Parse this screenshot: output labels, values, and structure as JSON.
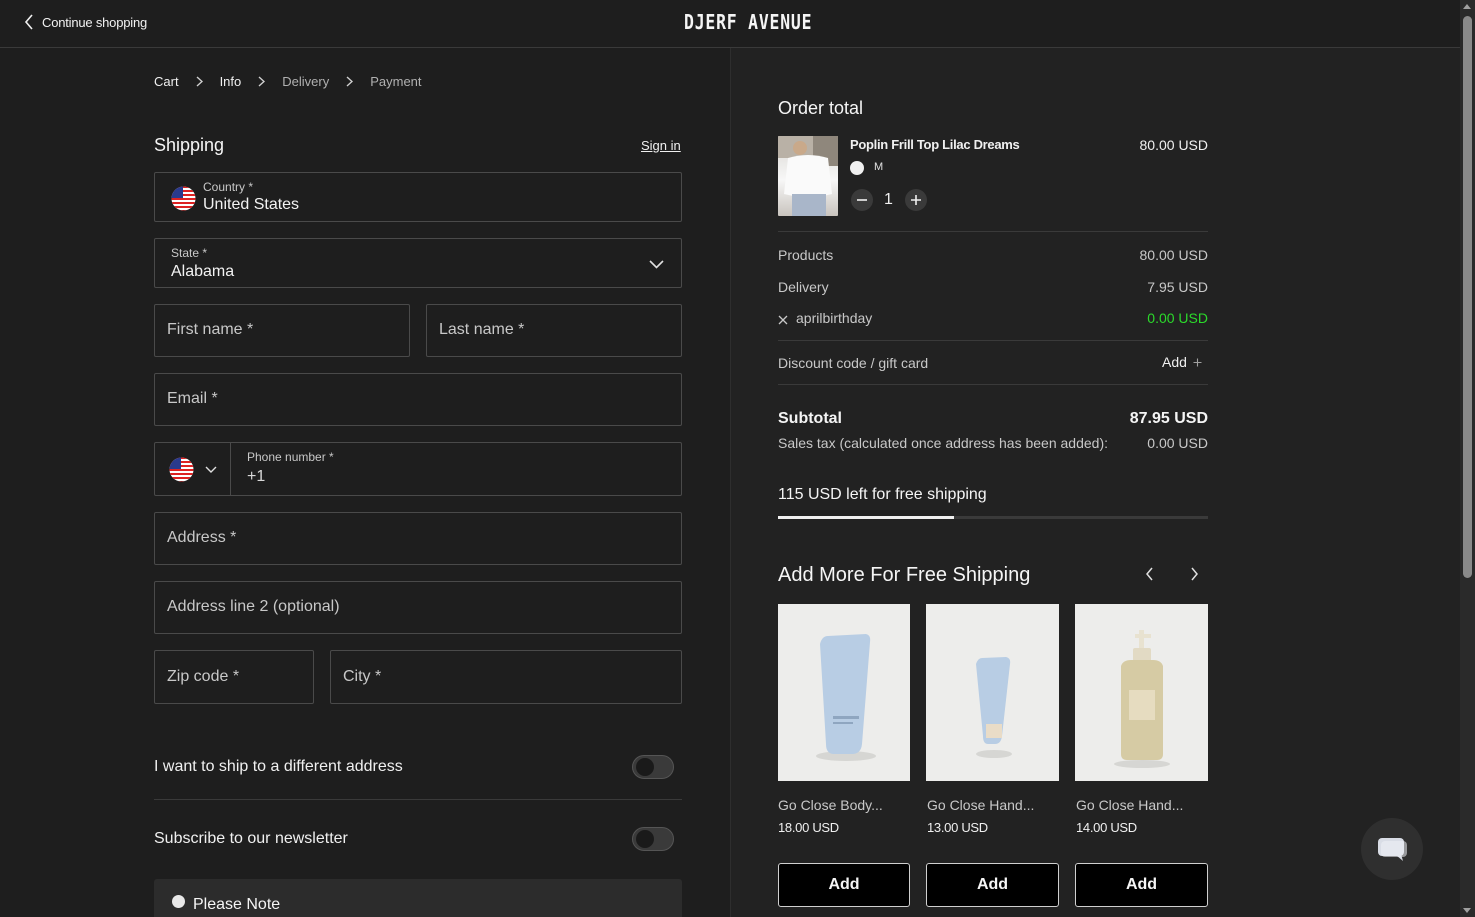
{
  "header": {
    "continue_label": "Continue shopping",
    "logo_text": "DJERF AVENUE"
  },
  "breadcrumb": [
    "Cart",
    "Info",
    "Delivery",
    "Payment"
  ],
  "shipping": {
    "title": "Shipping",
    "sign_in": "Sign in",
    "country_label": "Country *",
    "country_value": "United States",
    "state_label": "State *",
    "state_value": "Alabama",
    "first_name": "First name *",
    "last_name": "Last name *",
    "email": "Email *",
    "phone_label": "Phone number *",
    "phone_value": "+1",
    "address": "Address *",
    "address2": "Address line 2 (optional)",
    "zip": "Zip code *",
    "city": "City *",
    "ship_different": "I want to ship to a different address",
    "newsletter": "Subscribe to our newsletter",
    "please_note": "Please Note"
  },
  "order": {
    "title": "Order total",
    "product": {
      "name": "Poplin Frill Top Lilac Dreams",
      "price": "80.00 USD",
      "size": "M",
      "quantity": "1"
    },
    "products_label": "Products",
    "products_value": "80.00 USD",
    "delivery_label": "Delivery",
    "delivery_value": "7.95 USD",
    "code_label": "aprilbirthday",
    "code_value": "0.00 USD",
    "discount_label": "Discount code / gift card",
    "discount_add": "Add",
    "subtotal_label": "Subtotal",
    "subtotal_value": "87.95 USD",
    "tax_label": "Sales tax (calculated once address has been added):",
    "tax_value": "0.00 USD",
    "free_shipping_text": "115 USD left for free shipping",
    "free_shipping_progress": 0.41
  },
  "upsell": {
    "title": "Add More For Free Shipping",
    "items": [
      {
        "name": "Go Close Body...",
        "price": "18.00 USD",
        "button": "Add"
      },
      {
        "name": "Go Close Hand...",
        "price": "13.00 USD",
        "button": "Add"
      },
      {
        "name": "Go Close Hand...",
        "price": "14.00 USD",
        "button": "Add"
      }
    ]
  },
  "colors": {
    "background": "#1e1e1e",
    "panel": "#222222",
    "accent_green": "#2bd92b"
  }
}
